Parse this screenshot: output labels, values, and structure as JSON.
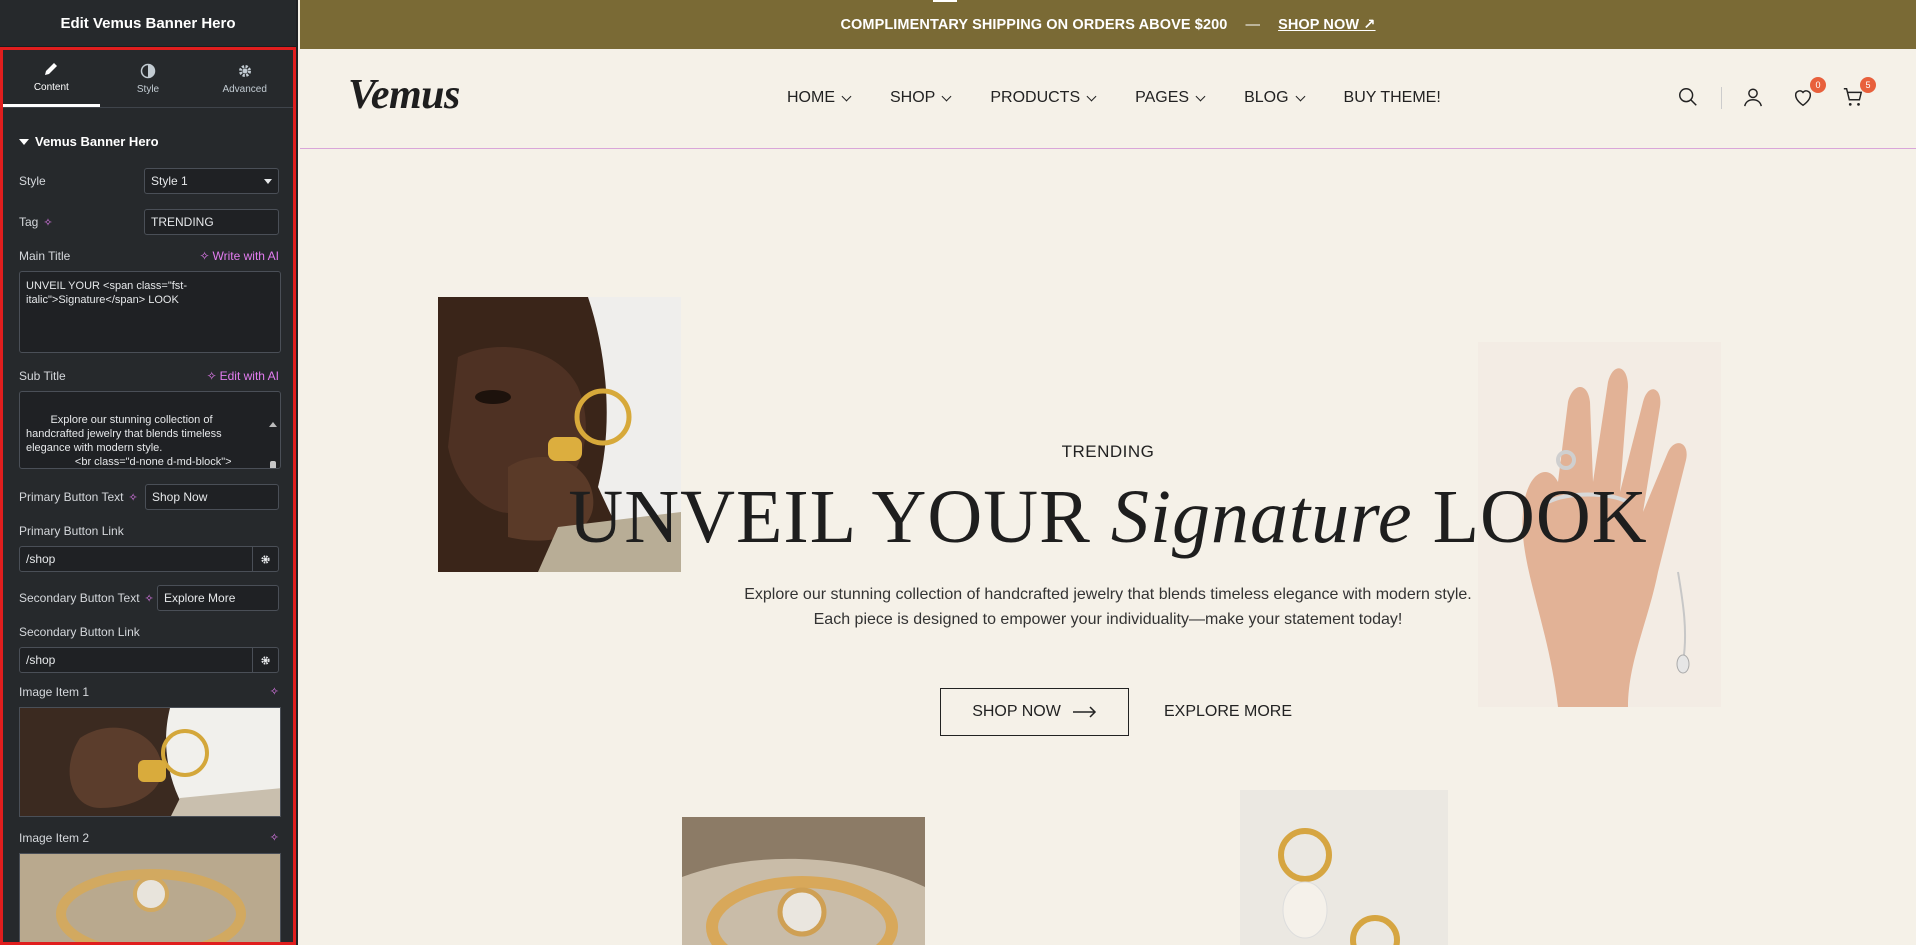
{
  "panel": {
    "title": "Edit Vemus Banner Hero",
    "tabs": [
      {
        "label": "Content",
        "icon": "pencil-icon"
      },
      {
        "label": "Style",
        "icon": "half-circle-icon"
      },
      {
        "label": "Advanced",
        "icon": "gear-icon"
      }
    ],
    "section_title": "Vemus Banner Hero",
    "style_label": "Style",
    "style_value": "Style 1",
    "tag_label": "Tag",
    "tag_value": "TRENDING",
    "main_title_label": "Main Title",
    "write_ai": "Write with AI",
    "main_title_value": "UNVEIL YOUR <span class=\"fst-italic\">Signature</span> LOOK",
    "sub_title_label": "Sub Title",
    "edit_ai": "Edit with AI",
    "sub_title_value": "Explore our stunning collection of handcrafted jewelry that blends timeless elegance with modern style.\n                <br class=\"d-none d-md-block\">\n                Each piece is designed to",
    "primary_btn_label": "Primary Button Text",
    "primary_btn_value": "Shop Now",
    "primary_link_label": "Primary Button Link",
    "primary_link_value": "/shop",
    "secondary_btn_label": "Secondary Button Text",
    "secondary_btn_value": "Explore More",
    "secondary_link_label": "Secondary Button Link",
    "secondary_link_value": "/shop",
    "image1_label": "Image Item 1",
    "image2_label": "Image Item 2"
  },
  "site": {
    "promo_text": "COMPLIMENTARY SHIPPING ON ORDERS ABOVE $200",
    "promo_dash": "—",
    "promo_link": "SHOP NOW ↗",
    "logo": "Vemus",
    "menu": [
      "HOME",
      "SHOP",
      "PRODUCTS",
      "PAGES",
      "BLOG",
      "BUY THEME!"
    ],
    "wishlist_count": "0",
    "cart_count": "5",
    "hero": {
      "tag": "TRENDING",
      "title_a": "UNVEIL YOUR ",
      "title_italic": "Signature",
      "title_b": " LOOK",
      "subtitle_1": "Explore our stunning collection of handcrafted jewelry that blends timeless elegance with modern style.",
      "subtitle_2": "Each piece is designed to empower your individuality—make your statement today!",
      "btn_primary": "SHOP NOW",
      "btn_secondary": "EXPLORE MORE"
    }
  },
  "colors": {
    "promo_bg": "#7a6a35",
    "page_bg": "#f5f1e8",
    "panel_bg": "#26292c",
    "ai_accent": "#e37cf0",
    "badge": "#e8603c",
    "selection_outline": "#e01e1e"
  }
}
